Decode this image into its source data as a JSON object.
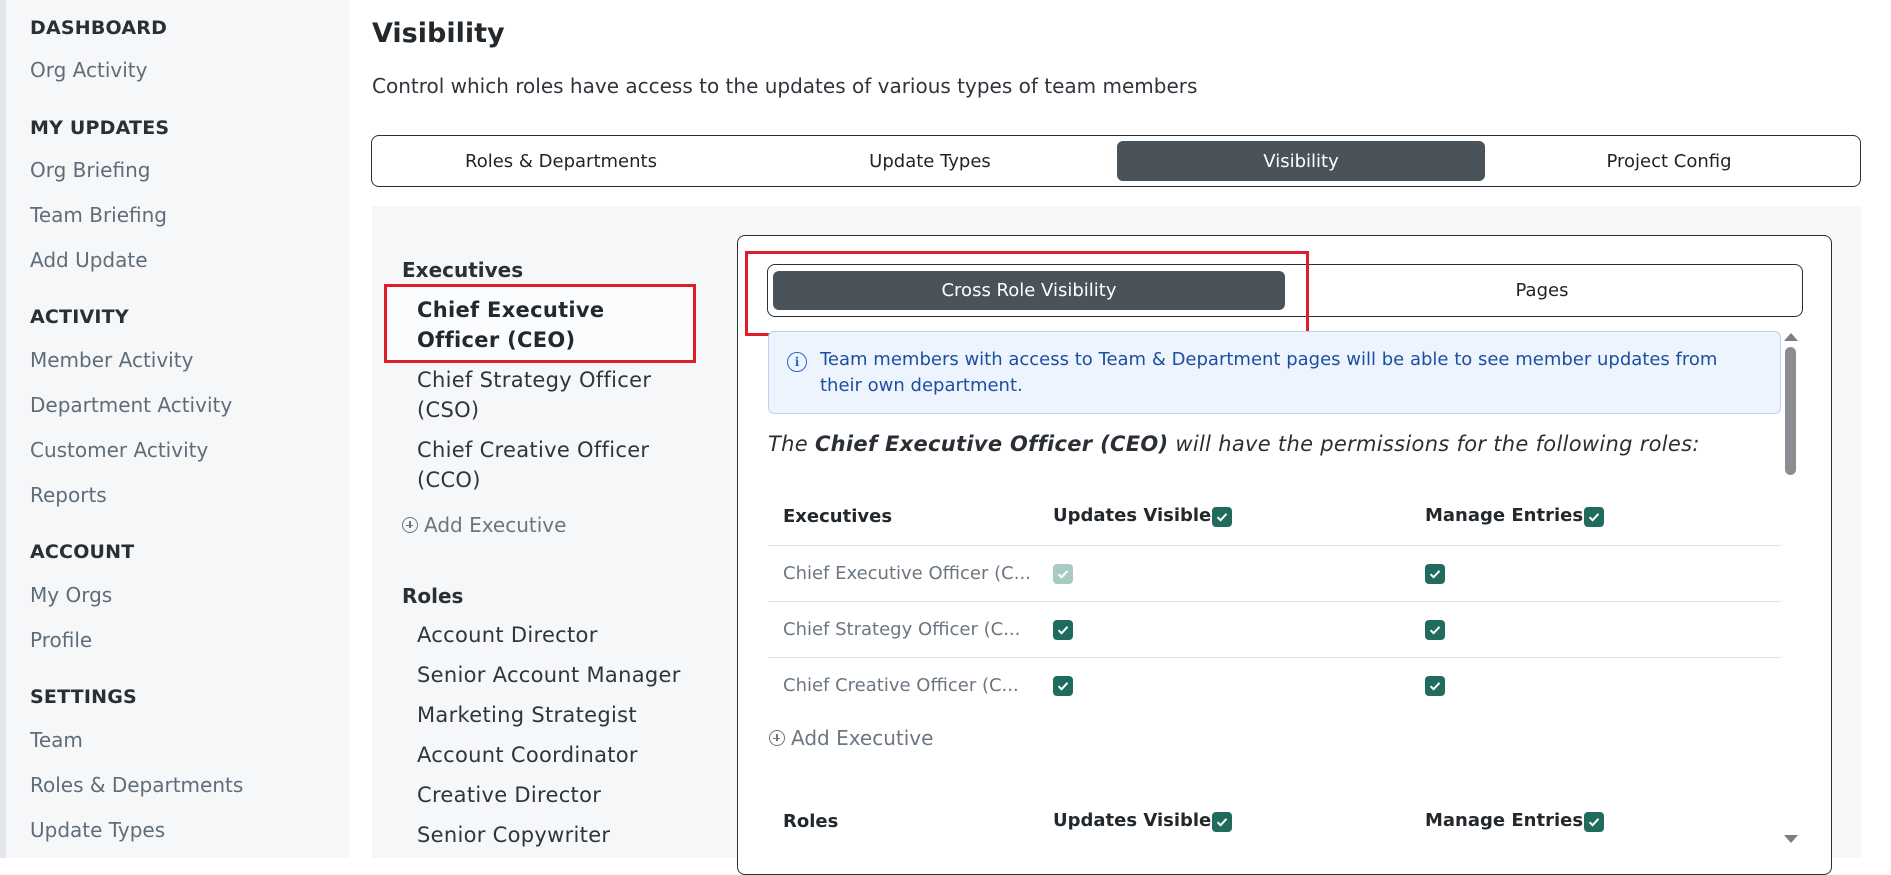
{
  "sidebar": {
    "sections": [
      {
        "heading": "DASHBOARD",
        "items": [
          "Org Activity"
        ]
      },
      {
        "heading": "MY UPDATES",
        "items": [
          "Org Briefing",
          "Team Briefing",
          "Add Update"
        ]
      },
      {
        "heading": "ACTIVITY",
        "items": [
          "Member Activity",
          "Department Activity",
          "Customer Activity",
          "Reports"
        ]
      },
      {
        "heading": "ACCOUNT",
        "items": [
          "My Orgs",
          "Profile"
        ]
      },
      {
        "heading": "SETTINGS",
        "items": [
          "Team",
          "Roles & Departments",
          "Update Types"
        ]
      }
    ]
  },
  "page": {
    "title": "Visibility",
    "subtitle": "Control which roles have access to the updates of various types of team members"
  },
  "tabs": [
    "Roles & Departments",
    "Update Types",
    "Visibility",
    "Project Config"
  ],
  "active_tab": "Visibility",
  "role_list": {
    "executives_heading": "Executives",
    "executives": [
      "Chief Executive Officer (CEO)",
      "Chief Strategy Officer (CSO)",
      "Chief Creative Officer (CCO)"
    ],
    "add_executive": "Add Executive",
    "roles_heading": "Roles",
    "roles": [
      "Account Director",
      "Senior Account Manager",
      "Marketing Strategist",
      "Account Coordinator",
      "Creative Director",
      "Senior Copywriter"
    ]
  },
  "subtabs": [
    "Cross Role Visibility",
    "Pages"
  ],
  "active_subtab": "Cross Role Visibility",
  "info": {
    "icon": "info-icon",
    "text": "Team members with access to Team & Department pages will be able to see member updates from their own department."
  },
  "permission": {
    "prefix": "The ",
    "role": "Chief Executive Officer (CEO)",
    "suffix": " will have the permissions for the following roles:"
  },
  "table": {
    "exec_header": "Executives",
    "col_updates": "Updates Visible",
    "col_manage": "Manage Entries",
    "rows": [
      {
        "name": "Chief Executive Officer (C...",
        "updates_visible": true,
        "updates_disabled": true,
        "manage_entries": true
      },
      {
        "name": "Chief Strategy Officer (C...",
        "updates_visible": true,
        "updates_disabled": false,
        "manage_entries": true
      },
      {
        "name": "Chief Creative Officer (C...",
        "updates_visible": true,
        "updates_disabled": false,
        "manage_entries": true
      }
    ],
    "add_executive": "Add Executive",
    "roles_header": "Roles"
  },
  "colors": {
    "active_tab_bg": "#4a5359",
    "checkbox": "#1f6b5d",
    "highlight_red": "#e01e2a",
    "info_text": "#1c4fa0"
  }
}
